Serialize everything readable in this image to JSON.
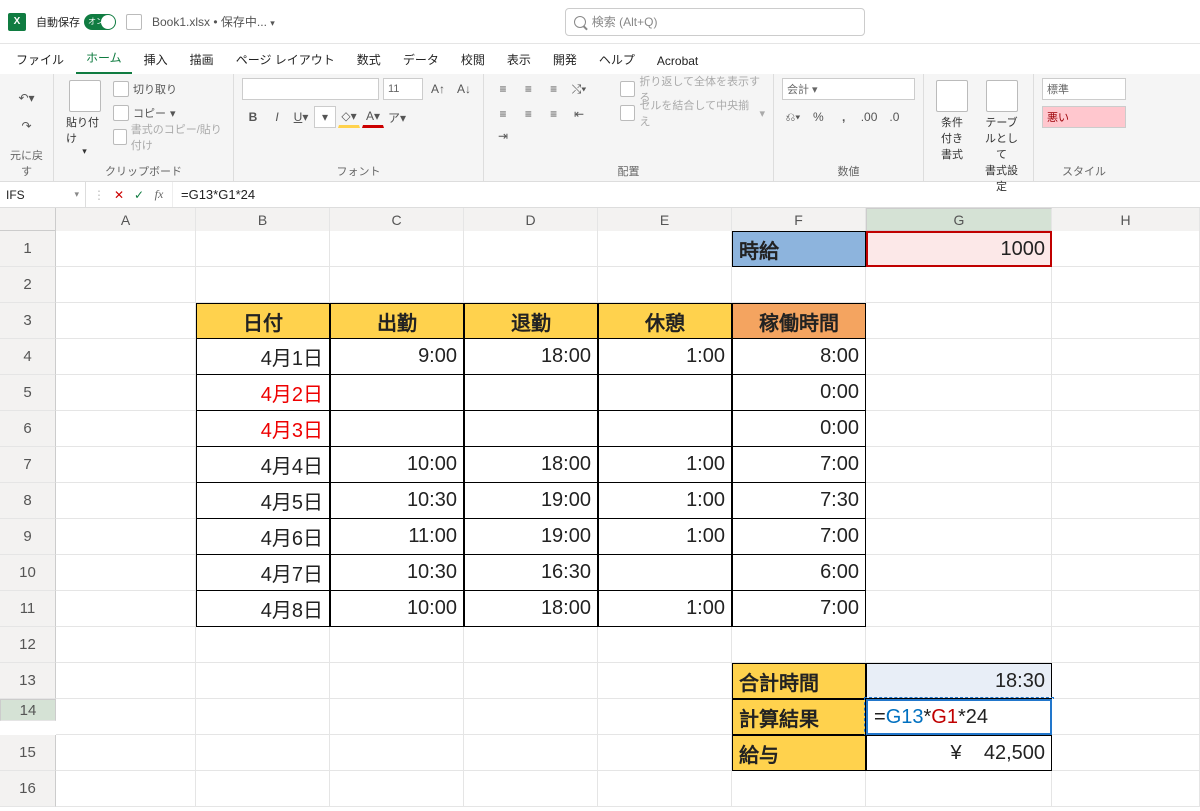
{
  "title": {
    "autosave": "自動保存",
    "toggle": "オン",
    "filename": "Book1.xlsx",
    "status": "保存中...",
    "search_ph": "検索 (Alt+Q)"
  },
  "tabs": [
    "ファイル",
    "ホーム",
    "挿入",
    "描画",
    "ページ レイアウト",
    "数式",
    "データ",
    "校閲",
    "表示",
    "開発",
    "ヘルプ",
    "Acrobat"
  ],
  "ribbon": {
    "undo": "元に戻す",
    "clipboard": {
      "paste": "貼り付け",
      "cut": "切り取り",
      "copy": "コピー",
      "fmt": "書式のコピー/貼り付け",
      "cap": "クリップボード"
    },
    "font": {
      "cap": "フォント",
      "size": "11"
    },
    "align": {
      "cap": "配置",
      "wrap": "折り返して全体を表示する",
      "merge": "セルを結合して中央揃え"
    },
    "number": {
      "cap": "数値",
      "fmt": "会計"
    },
    "styles": {
      "cond": "条件付き\n書式",
      "table": "テーブルとして\n書式設定",
      "normal": "標準",
      "bad": "悪い",
      "cap": "スタイル"
    }
  },
  "fbar": {
    "name": "IFS",
    "formula": "=G13*G1*24"
  },
  "cols": [
    "A",
    "B",
    "C",
    "D",
    "E",
    "F",
    "G",
    "H"
  ],
  "rows": [
    "1",
    "2",
    "3",
    "4",
    "5",
    "6",
    "7",
    "8",
    "9",
    "10",
    "11",
    "12",
    "13",
    "14",
    "15",
    "16"
  ],
  "f1label": "時給",
  "g1": "1000",
  "hdr": {
    "b": "日付",
    "c": "出勤",
    "d": "退勤",
    "e": "休憩",
    "f": "稼働時間"
  },
  "data": [
    {
      "b": "4月1日",
      "c": "9:00",
      "d": "18:00",
      "e": "1:00",
      "f": "8:00",
      "red": false
    },
    {
      "b": "4月2日",
      "c": "",
      "d": "",
      "e": "",
      "f": "0:00",
      "red": true
    },
    {
      "b": "4月3日",
      "c": "",
      "d": "",
      "e": "",
      "f": "0:00",
      "red": true
    },
    {
      "b": "4月4日",
      "c": "10:00",
      "d": "18:00",
      "e": "1:00",
      "f": "7:00",
      "red": false
    },
    {
      "b": "4月5日",
      "c": "10:30",
      "d": "19:00",
      "e": "1:00",
      "f": "7:30",
      "red": false
    },
    {
      "b": "4月6日",
      "c": "11:00",
      "d": "19:00",
      "e": "1:00",
      "f": "7:00",
      "red": false
    },
    {
      "b": "4月7日",
      "c": "10:30",
      "d": "16:30",
      "e": "",
      "f": "6:00",
      "red": false
    },
    {
      "b": "4月8日",
      "c": "10:00",
      "d": "18:00",
      "e": "1:00",
      "f": "7:00",
      "red": false
    }
  ],
  "sum": {
    "f13": "合計時間",
    "g13": "18:30",
    "f14": "計算結果",
    "g14": "=G13*G1*24",
    "f15": "給与",
    "g15": "¥    42,500"
  }
}
